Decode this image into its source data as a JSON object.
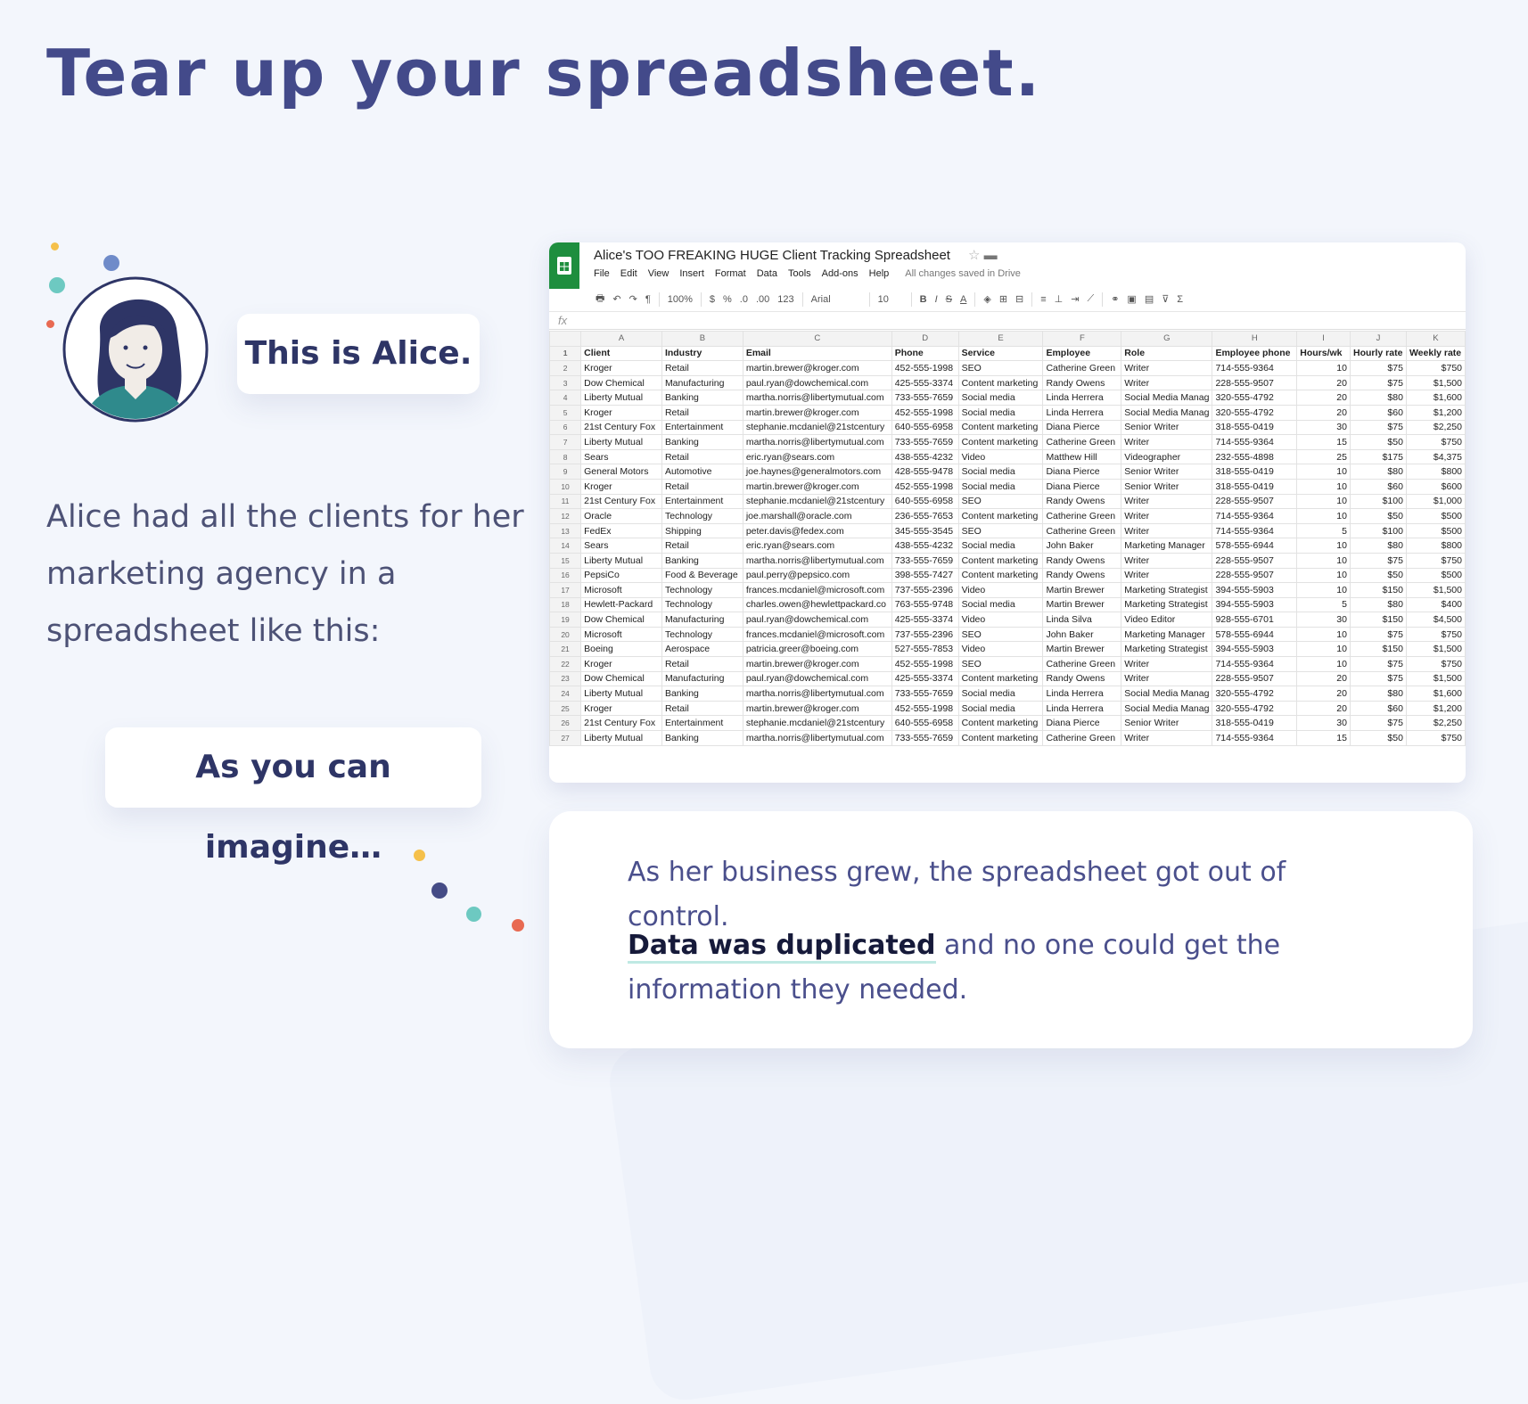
{
  "headline": "Tear up your spreadsheet.",
  "alice_bubble": "This is Alice.",
  "intro_text": "Alice had all the clients for her marketing agency in a spreadsheet like this:",
  "imagine_bubble": "As you can imagine…",
  "card": {
    "line1": "As her business grew, the spreadsheet got out of control.",
    "bold": "Data was duplicated",
    "rest": "and no one could get the information they needed."
  },
  "colors": {
    "background": "#f3f6fc",
    "headline": "#434a8a",
    "sheets_green": "#1e8e3e",
    "dot_yellow": "#f5c04a",
    "dot_navy": "#454c86",
    "dot_teal": "#6dc9c1",
    "dot_red": "#e86a52",
    "dot_blue": "#6f8bc9"
  },
  "spreadsheet": {
    "title": "Alice's TOO FREAKING HUGE Client Tracking Spreadsheet",
    "menu": [
      "File",
      "Edit",
      "View",
      "Insert",
      "Format",
      "Data",
      "Tools",
      "Add-ons",
      "Help"
    ],
    "saved_status": "All changes saved in Drive",
    "toolbar": {
      "zoom": "100%",
      "currency": "$",
      "percent": "%",
      "dec_less": ".0",
      "dec_more": ".00",
      "format": "123",
      "font": "Arial",
      "font_size": "10"
    },
    "fx": "fx",
    "columns": [
      "A",
      "B",
      "C",
      "D",
      "E",
      "F",
      "G",
      "H",
      "I",
      "J",
      "K"
    ],
    "header": [
      "Client",
      "Industry",
      "Email",
      "Phone",
      "Service",
      "Employee",
      "Role",
      "Employee phone",
      "Hours/wk",
      "Hourly rate",
      "Weekly rate"
    ],
    "rows": [
      [
        "Kroger",
        "Retail",
        "martin.brewer@kroger.com",
        "452-555-1998",
        "SEO",
        "Catherine Green",
        "Writer",
        "714-555-9364",
        "10",
        "$75",
        "$750"
      ],
      [
        "Dow Chemical",
        "Manufacturing",
        "paul.ryan@dowchemical.com",
        "425-555-3374",
        "Content marketing",
        "Randy Owens",
        "Writer",
        "228-555-9507",
        "20",
        "$75",
        "$1,500"
      ],
      [
        "Liberty Mutual",
        "Banking",
        "martha.norris@libertymutual.com",
        "733-555-7659",
        "Social media",
        "Linda Herrera",
        "Social Media Manag",
        "320-555-4792",
        "20",
        "$80",
        "$1,600"
      ],
      [
        "Kroger",
        "Retail",
        "martin.brewer@kroger.com",
        "452-555-1998",
        "Social media",
        "Linda Herrera",
        "Social Media Manag",
        "320-555-4792",
        "20",
        "$60",
        "$1,200"
      ],
      [
        "21st Century Fox",
        "Entertainment",
        "stephanie.mcdaniel@21stcentury",
        "640-555-6958",
        "Content marketing",
        "Diana Pierce",
        "Senior Writer",
        "318-555-0419",
        "30",
        "$75",
        "$2,250"
      ],
      [
        "Liberty Mutual",
        "Banking",
        "martha.norris@libertymutual.com",
        "733-555-7659",
        "Content marketing",
        "Catherine Green",
        "Writer",
        "714-555-9364",
        "15",
        "$50",
        "$750"
      ],
      [
        "Sears",
        "Retail",
        "eric.ryan@sears.com",
        "438-555-4232",
        "Video",
        "Matthew Hill",
        "Videographer",
        "232-555-4898",
        "25",
        "$175",
        "$4,375"
      ],
      [
        "General Motors",
        "Automotive",
        "joe.haynes@generalmotors.com",
        "428-555-9478",
        "Social media",
        "Diana Pierce",
        "Senior Writer",
        "318-555-0419",
        "10",
        "$80",
        "$800"
      ],
      [
        "Kroger",
        "Retail",
        "martin.brewer@kroger.com",
        "452-555-1998",
        "Social media",
        "Diana Pierce",
        "Senior Writer",
        "318-555-0419",
        "10",
        "$60",
        "$600"
      ],
      [
        "21st Century Fox",
        "Entertainment",
        "stephanie.mcdaniel@21stcentury",
        "640-555-6958",
        "SEO",
        "Randy Owens",
        "Writer",
        "228-555-9507",
        "10",
        "$100",
        "$1,000"
      ],
      [
        "Oracle",
        "Technology",
        "joe.marshall@oracle.com",
        "236-555-7653",
        "Content marketing",
        "Catherine Green",
        "Writer",
        "714-555-9364",
        "10",
        "$50",
        "$500"
      ],
      [
        "FedEx",
        "Shipping",
        "peter.davis@fedex.com",
        "345-555-3545",
        "SEO",
        "Catherine Green",
        "Writer",
        "714-555-9364",
        "5",
        "$100",
        "$500"
      ],
      [
        "Sears",
        "Retail",
        "eric.ryan@sears.com",
        "438-555-4232",
        "Social media",
        "John Baker",
        "Marketing Manager",
        "578-555-6944",
        "10",
        "$80",
        "$800"
      ],
      [
        "Liberty Mutual",
        "Banking",
        "martha.norris@libertymutual.com",
        "733-555-7659",
        "Content marketing",
        "Randy Owens",
        "Writer",
        "228-555-9507",
        "10",
        "$75",
        "$750"
      ],
      [
        "PepsiCo",
        "Food & Beverage",
        "paul.perry@pepsico.com",
        "398-555-7427",
        "Content marketing",
        "Randy Owens",
        "Writer",
        "228-555-9507",
        "10",
        "$50",
        "$500"
      ],
      [
        "Microsoft",
        "Technology",
        "frances.mcdaniel@microsoft.com",
        "737-555-2396",
        "Video",
        "Martin Brewer",
        "Marketing Strategist",
        "394-555-5903",
        "10",
        "$150",
        "$1,500"
      ],
      [
        "Hewlett-Packard",
        "Technology",
        "charles.owen@hewlettpackard.co",
        "763-555-9748",
        "Social media",
        "Martin Brewer",
        "Marketing Strategist",
        "394-555-5903",
        "5",
        "$80",
        "$400"
      ],
      [
        "Dow Chemical",
        "Manufacturing",
        "paul.ryan@dowchemical.com",
        "425-555-3374",
        "Video",
        "Linda Silva",
        "Video Editor",
        "928-555-6701",
        "30",
        "$150",
        "$4,500"
      ],
      [
        "Microsoft",
        "Technology",
        "frances.mcdaniel@microsoft.com",
        "737-555-2396",
        "SEO",
        "John Baker",
        "Marketing Manager",
        "578-555-6944",
        "10",
        "$75",
        "$750"
      ],
      [
        "Boeing",
        "Aerospace",
        "patricia.greer@boeing.com",
        "527-555-7853",
        "Video",
        "Martin Brewer",
        "Marketing Strategist",
        "394-555-5903",
        "10",
        "$150",
        "$1,500"
      ],
      [
        "Kroger",
        "Retail",
        "martin.brewer@kroger.com",
        "452-555-1998",
        "SEO",
        "Catherine Green",
        "Writer",
        "714-555-9364",
        "10",
        "$75",
        "$750"
      ],
      [
        "Dow Chemical",
        "Manufacturing",
        "paul.ryan@dowchemical.com",
        "425-555-3374",
        "Content marketing",
        "Randy Owens",
        "Writer",
        "228-555-9507",
        "20",
        "$75",
        "$1,500"
      ],
      [
        "Liberty Mutual",
        "Banking",
        "martha.norris@libertymutual.com",
        "733-555-7659",
        "Social media",
        "Linda Herrera",
        "Social Media Manag",
        "320-555-4792",
        "20",
        "$80",
        "$1,600"
      ],
      [
        "Kroger",
        "Retail",
        "martin.brewer@kroger.com",
        "452-555-1998",
        "Social media",
        "Linda Herrera",
        "Social Media Manag",
        "320-555-4792",
        "20",
        "$60",
        "$1,200"
      ],
      [
        "21st Century Fox",
        "Entertainment",
        "stephanie.mcdaniel@21stcentury",
        "640-555-6958",
        "Content marketing",
        "Diana Pierce",
        "Senior Writer",
        "318-555-0419",
        "30",
        "$75",
        "$2,250"
      ],
      [
        "Liberty Mutual",
        "Banking",
        "martha.norris@libertymutual.com",
        "733-555-7659",
        "Content marketing",
        "Catherine Green",
        "Writer",
        "714-555-9364",
        "15",
        "$50",
        "$750"
      ]
    ]
  }
}
